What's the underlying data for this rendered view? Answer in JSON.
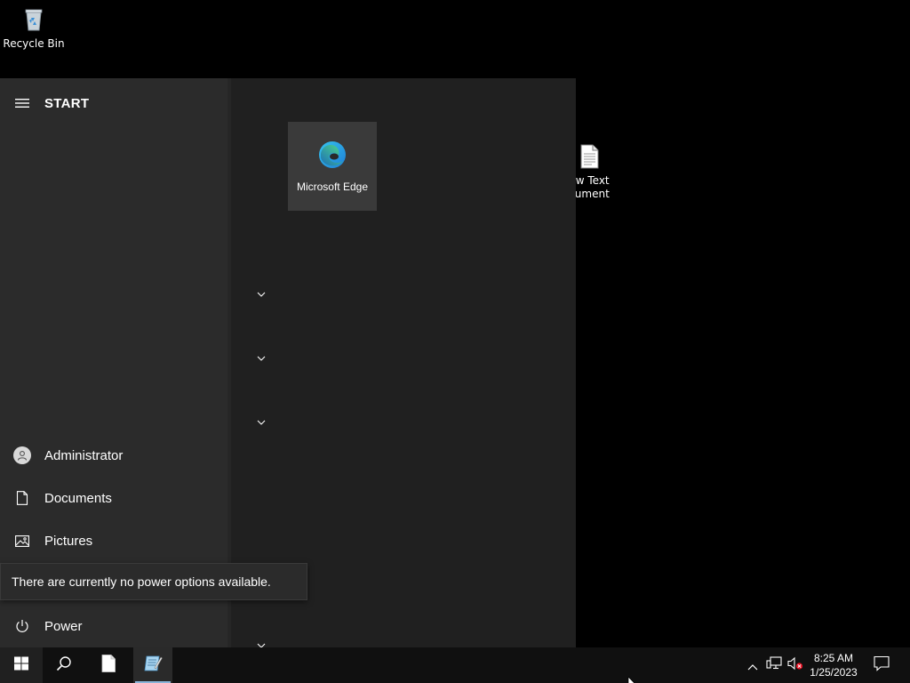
{
  "desktop": {
    "recycle_bin_label": "Recycle Bin",
    "text_document_label": "ew Text\ncument"
  },
  "start_menu": {
    "title": "START",
    "left_items": {
      "user": "Administrator",
      "documents": "Documents",
      "pictures": "Pictures",
      "power": "Power"
    },
    "tooltip": "There are currently no power options available.",
    "tiles": [
      {
        "label": "Microsoft Edge",
        "icon": "edge-icon"
      }
    ]
  },
  "taskbar": {
    "time": "8:25 AM",
    "date": "1/25/2023"
  },
  "colors": {
    "desktop_bg": "#000000",
    "start_left_bg": "#2b2b2b",
    "start_right_bg": "#202020",
    "tile_bg": "#3a3a3a",
    "taskbar_bg": "#101010",
    "accent_underline": "#8ab4d9"
  }
}
